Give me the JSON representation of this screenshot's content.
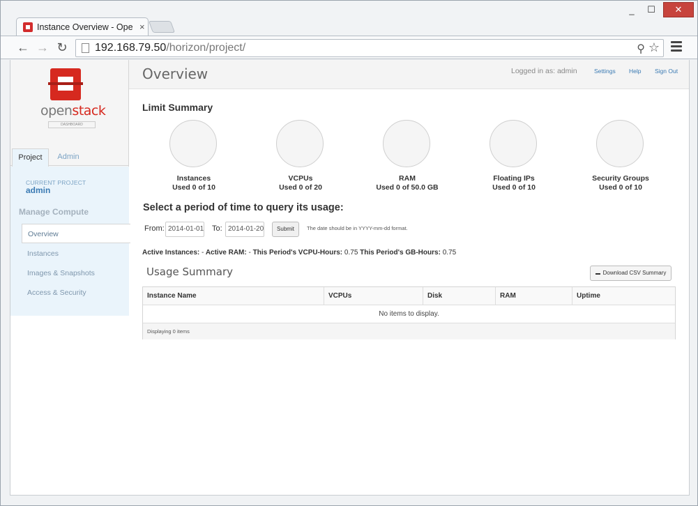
{
  "browser": {
    "tab_title": "Instance Overview - OpenStack Dashboard",
    "tab_close": "×",
    "url_host": "192.168.79.50",
    "url_path": "/horizon/project/",
    "controls": {
      "minimize": "_",
      "maximize": "☐",
      "close": "✕"
    },
    "icons": {
      "back": "arrow-left-icon",
      "forward": "arrow-right-icon",
      "reload": "reload-icon",
      "search": "magnifier-icon",
      "star": "star-icon",
      "menu": "hamburger-icon"
    }
  },
  "sidebar": {
    "logo": {
      "open": "open",
      "stack": "stack",
      "sub": "DASHBOARD"
    },
    "tabs": [
      {
        "label": "Project"
      },
      {
        "label": "Admin"
      }
    ],
    "current_project_label": "CURRENT PROJECT",
    "current_project": "admin",
    "section_title": "Manage Compute",
    "items": [
      {
        "label": "Overview"
      },
      {
        "label": "Instances"
      },
      {
        "label": "Images & Snapshots"
      },
      {
        "label": "Access & Security"
      }
    ]
  },
  "header": {
    "title": "Overview",
    "logged_in": "Logged in as: admin",
    "settings": "Settings",
    "help": "Help",
    "sign_out": "Sign Out"
  },
  "limit_summary": {
    "title": "Limit Summary",
    "items": [
      {
        "name": "Instances",
        "usage": "Used 0 of 10",
        "used": 0,
        "limit": 10
      },
      {
        "name": "VCPUs",
        "usage": "Used 0 of 20",
        "used": 0,
        "limit": 20
      },
      {
        "name": "RAM",
        "usage": "Used 0 of 50.0 GB",
        "used": 0,
        "limit": 50
      },
      {
        "name": "Floating IPs",
        "usage": "Used 0 of 10",
        "used": 0,
        "limit": 10
      },
      {
        "name": "Security Groups",
        "usage": "Used 0 of 10",
        "used": 0,
        "limit": 10
      }
    ]
  },
  "period": {
    "title": "Select a period of time to query its usage:",
    "from_label": "From:",
    "from_value": "2014-01-01",
    "to_label": "To:",
    "to_value": "2014-01-20",
    "submit": "Submit",
    "hint": "The date should be in YYYY-mm-dd format."
  },
  "active_summary": {
    "instances_label": "Active Instances:",
    "instances_value": "-",
    "ram_label": "Active RAM:",
    "ram_value": "-",
    "vcpu_label": "This Period's VCPU-Hours:",
    "vcpu_value": "0.75",
    "gb_label": "This Period's GB-Hours:",
    "gb_value": "0.75"
  },
  "usage": {
    "title": "Usage Summary",
    "csv_button": "Download CSV Summary",
    "columns": [
      "Instance Name",
      "VCPUs",
      "Disk",
      "RAM",
      "Uptime"
    ],
    "empty": "No items to display.",
    "footer": "Displaying 0 items"
  }
}
